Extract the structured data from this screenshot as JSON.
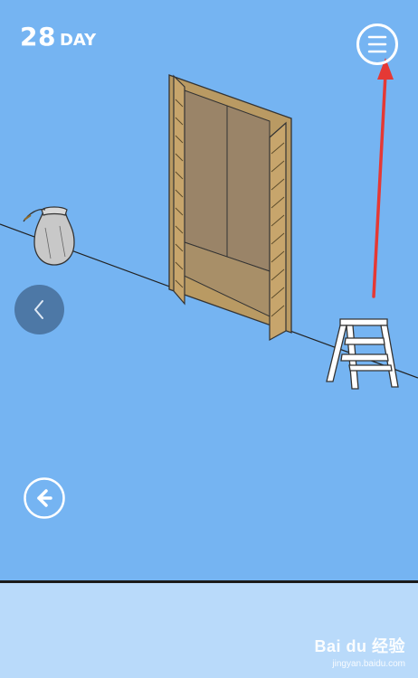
{
  "hud": {
    "day_number": "28",
    "day_label": "DAY"
  },
  "icons": {
    "menu": "hamburger-menu-icon",
    "nav_left": "chevron-left-icon",
    "back": "back-arrow-icon"
  },
  "scene": {
    "objects": [
      "vase",
      "open-cabinet",
      "step-ladder"
    ],
    "annotation": "red-arrow-pointing-to-menu"
  },
  "watermark": {
    "brand": "Bai du 经验",
    "site": "jingyan.baidu.com"
  },
  "colors": {
    "background": "#75b4f2",
    "footer": "#b9dafa",
    "cabinet_interior": "#9a8468",
    "cabinet_frame": "#b99a63",
    "nav_button": "#4d78a6",
    "annotation_arrow": "#e53935"
  }
}
